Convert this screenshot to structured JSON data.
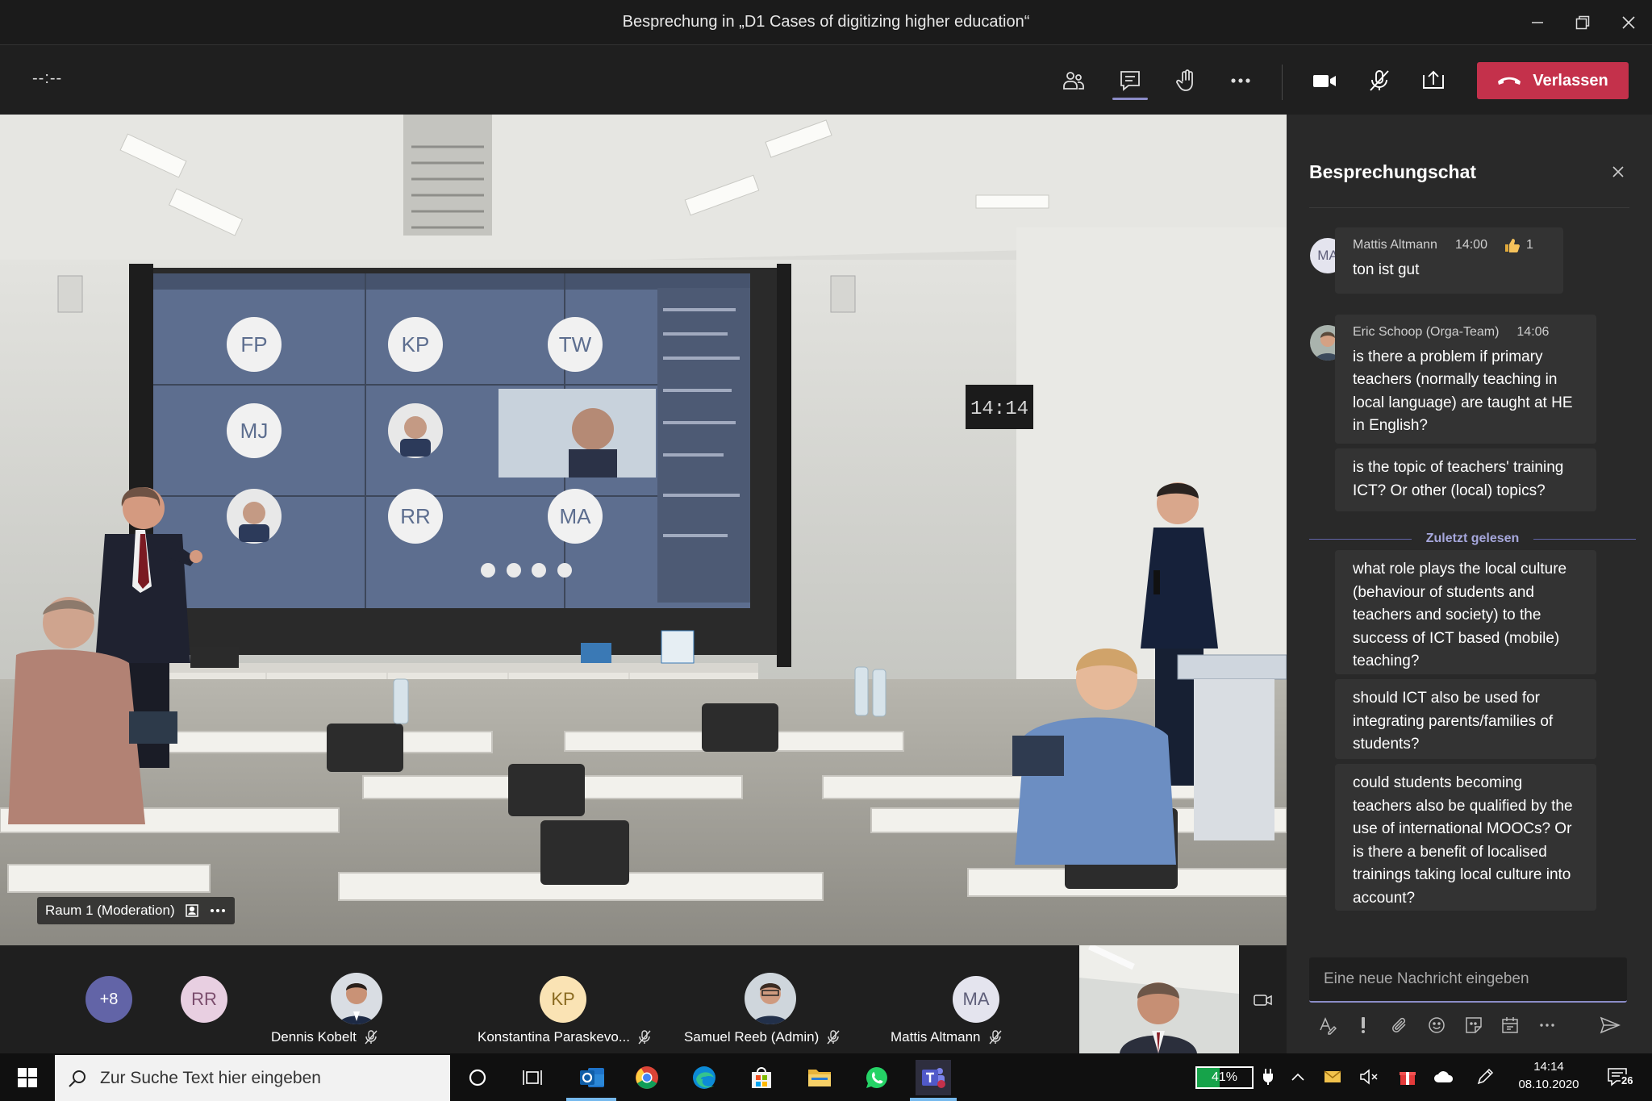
{
  "window": {
    "title": "Besprechung in „D1 Cases of digitizing higher education“"
  },
  "toolbar": {
    "timer": "--:--",
    "leave_label": "Verlassen"
  },
  "stage": {
    "room_label": "Raum 1 (Moderation)",
    "screen_tiles": [
      "FP",
      "KP",
      "TW",
      "MJ",
      "RR",
      "MA"
    ],
    "wall_clock": "14:14"
  },
  "participants": {
    "overflow_count": "+8",
    "items": [
      {
        "initials": "RR",
        "name": ""
      },
      {
        "initials": "",
        "name": "Dennis Kobelt"
      },
      {
        "initials": "KP",
        "name": "Konstantina Paraskevo..."
      },
      {
        "initials": "",
        "name": "Samuel Reeb (Admin)"
      },
      {
        "initials": "MA",
        "name": "Mattis Altmann"
      }
    ]
  },
  "chat": {
    "title": "Besprechungschat",
    "messages": [
      {
        "author": "Mattis Altmann",
        "initials": "MA",
        "time": "14:00",
        "reaction_count": "1",
        "text": "ton ist gut"
      },
      {
        "author": "Eric Schoop (Orga-Team)",
        "time": "14:06",
        "text": "is there a problem if primary teachers (normally teaching in local language) are taught at HE in English?"
      },
      {
        "text": "is the topic of teachers' training ICT? Or other (local) topics?"
      },
      {
        "text": "what role plays the local culture (behaviour of students and teachers and society) to the success of ICT based (mobile) teaching?"
      },
      {
        "text": "should ICT also be used for integrating parents/families of students?"
      },
      {
        "text": "could students becoming teachers also be qualified by the use of international MOOCs? Or is there a benefit of localised trainings taking local culture into account?"
      }
    ],
    "last_read_label": "Zuletzt gelesen",
    "compose_placeholder": "Eine neue Nachricht eingeben"
  },
  "taskbar": {
    "search_placeholder": "Zur Suche Text hier eingeben",
    "battery": "41%",
    "battery_level": 0.41,
    "time": "14:14",
    "date": "08.10.2020",
    "notification_count": "26"
  },
  "colors": {
    "leave": "#c4314b",
    "accent": "#8b8cc7",
    "chat_bg": "#292929",
    "message_bg": "#333333"
  }
}
